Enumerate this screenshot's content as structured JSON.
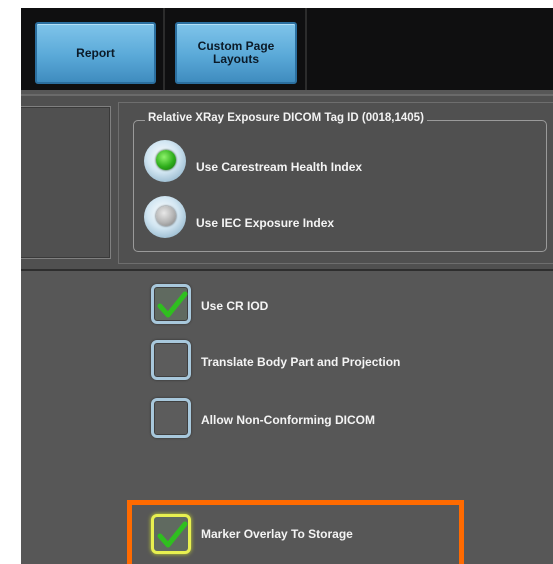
{
  "toolbar": {
    "report_label": "Report",
    "custom_layouts_label": "Custom Page\nLayouts"
  },
  "exposure": {
    "legend": "Relative XRay Exposure DICOM Tag ID (0018,1405)",
    "options": [
      {
        "label": "Use Carestream Health Index",
        "selected": true
      },
      {
        "label": "Use IEC Exposure Index",
        "selected": false
      }
    ]
  },
  "options": {
    "use_cr_iod": {
      "label": "Use CR IOD",
      "checked": true
    },
    "translate_body_part": {
      "label": "Translate Body Part and Projection",
      "checked": false
    },
    "allow_non_conforming": {
      "label": "Allow Non-Conforming DICOM",
      "checked": false
    },
    "marker_overlay": {
      "label": "Marker Overlay To Storage",
      "checked": true
    }
  },
  "colors": {
    "highlight": "#ff6a00",
    "tab_blue": "#5aa9d8",
    "check_green": "#2fbf1f"
  }
}
